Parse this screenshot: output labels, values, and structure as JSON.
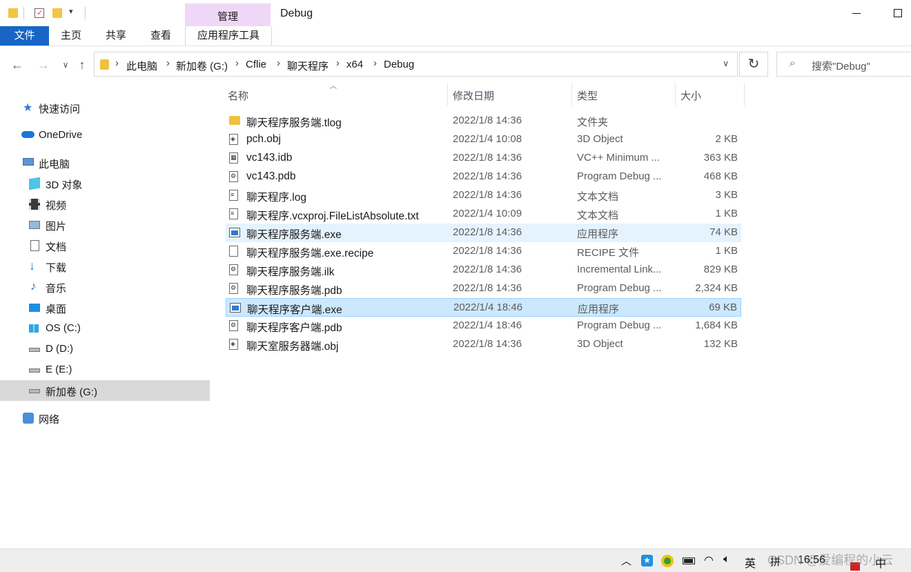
{
  "window": {
    "title": "Debug",
    "context_tab": "管理"
  },
  "ribbon": {
    "tabs": [
      "文件",
      "主页",
      "共享",
      "查看",
      "应用程序工具"
    ]
  },
  "address": {
    "crumbs": [
      "此电脑",
      "新加卷 (G:)",
      "Cflie",
      "聊天程序",
      "x64",
      "Debug"
    ]
  },
  "search": {
    "placeholder": "搜索\"Debug\""
  },
  "sidebar": {
    "items": [
      {
        "label": "快速访问",
        "icon": "star-icon"
      },
      {
        "label": "OneDrive",
        "icon": "cloud-icon"
      },
      {
        "label": "此电脑",
        "icon": "computer-icon"
      },
      {
        "label": "3D 对象",
        "icon": "3d-objects-icon"
      },
      {
        "label": "视频",
        "icon": "video-icon"
      },
      {
        "label": "图片",
        "icon": "pictures-icon"
      },
      {
        "label": "文档",
        "icon": "documents-icon"
      },
      {
        "label": "下载",
        "icon": "download-icon"
      },
      {
        "label": "音乐",
        "icon": "music-icon"
      },
      {
        "label": "桌面",
        "icon": "desktop-icon"
      },
      {
        "label": "OS (C:)",
        "icon": "windows-drive-icon"
      },
      {
        "label": "D (D:)",
        "icon": "drive-icon"
      },
      {
        "label": "E (E:)",
        "icon": "drive-icon"
      },
      {
        "label": "新加卷 (G:)",
        "icon": "drive-icon"
      },
      {
        "label": "网络",
        "icon": "network-icon"
      }
    ],
    "selected": "新加卷 (G:)"
  },
  "columns": {
    "name": "名称",
    "date": "修改日期",
    "type": "类型",
    "size": "大小"
  },
  "files": [
    {
      "name": "聊天程序服务端.tlog",
      "date": "2022/1/8 14:36",
      "type": "文件夹",
      "size": "",
      "icon": "folder-icon"
    },
    {
      "name": "pch.obj",
      "date": "2022/1/4 10:08",
      "type": "3D Object",
      "size": "2 KB",
      "icon": "3d-object-file-icon"
    },
    {
      "name": "vc143.idb",
      "date": "2022/1/8 14:36",
      "type": "VC++ Minimum ...",
      "size": "363 KB",
      "icon": "idb-file-icon"
    },
    {
      "name": "vc143.pdb",
      "date": "2022/1/8 14:36",
      "type": "Program Debug ...",
      "size": "468 KB",
      "icon": "pdb-file-icon"
    },
    {
      "name": "聊天程序.log",
      "date": "2022/1/8 14:36",
      "type": "文本文档",
      "size": "3 KB",
      "icon": "text-file-icon"
    },
    {
      "name": "聊天程序.vcxproj.FileListAbsolute.txt",
      "date": "2022/1/4 10:09",
      "type": "文本文档",
      "size": "1 KB",
      "icon": "text-file-icon"
    },
    {
      "name": "聊天程序服务端.exe",
      "date": "2022/1/8 14:36",
      "type": "应用程序",
      "size": "74 KB",
      "icon": "exe-file-icon"
    },
    {
      "name": "聊天程序服务端.exe.recipe",
      "date": "2022/1/8 14:36",
      "type": "RECIPE 文件",
      "size": "1 KB",
      "icon": "blank-file-icon"
    },
    {
      "name": "聊天程序服务端.ilk",
      "date": "2022/1/8 14:36",
      "type": "Incremental Link...",
      "size": "829 KB",
      "icon": "ilk-file-icon"
    },
    {
      "name": "聊天程序服务端.pdb",
      "date": "2022/1/8 14:36",
      "type": "Program Debug ...",
      "size": "2,324 KB",
      "icon": "pdb-file-icon"
    },
    {
      "name": "聊天程序客户端.exe",
      "date": "2022/1/4 18:46",
      "type": "应用程序",
      "size": "69 KB",
      "icon": "exe-file-icon"
    },
    {
      "name": "聊天程序客户端.pdb",
      "date": "2022/1/4 18:46",
      "type": "Program Debug ...",
      "size": "1,684 KB",
      "icon": "pdb-file-icon"
    },
    {
      "name": "聊天室服务器端.obj",
      "date": "2022/1/8 14:36",
      "type": "3D Object",
      "size": "132 KB",
      "icon": "3d-object-file-icon"
    }
  ],
  "hovered_file": "聊天程序服务端.exe",
  "selected_file": "聊天程序客户端.exe",
  "taskbar": {
    "ime_lang": "英",
    "ime_mode": "拼",
    "clock": "16:56",
    "ime_icon": "中",
    "watermark": "CSDN @爱编程的小云"
  }
}
